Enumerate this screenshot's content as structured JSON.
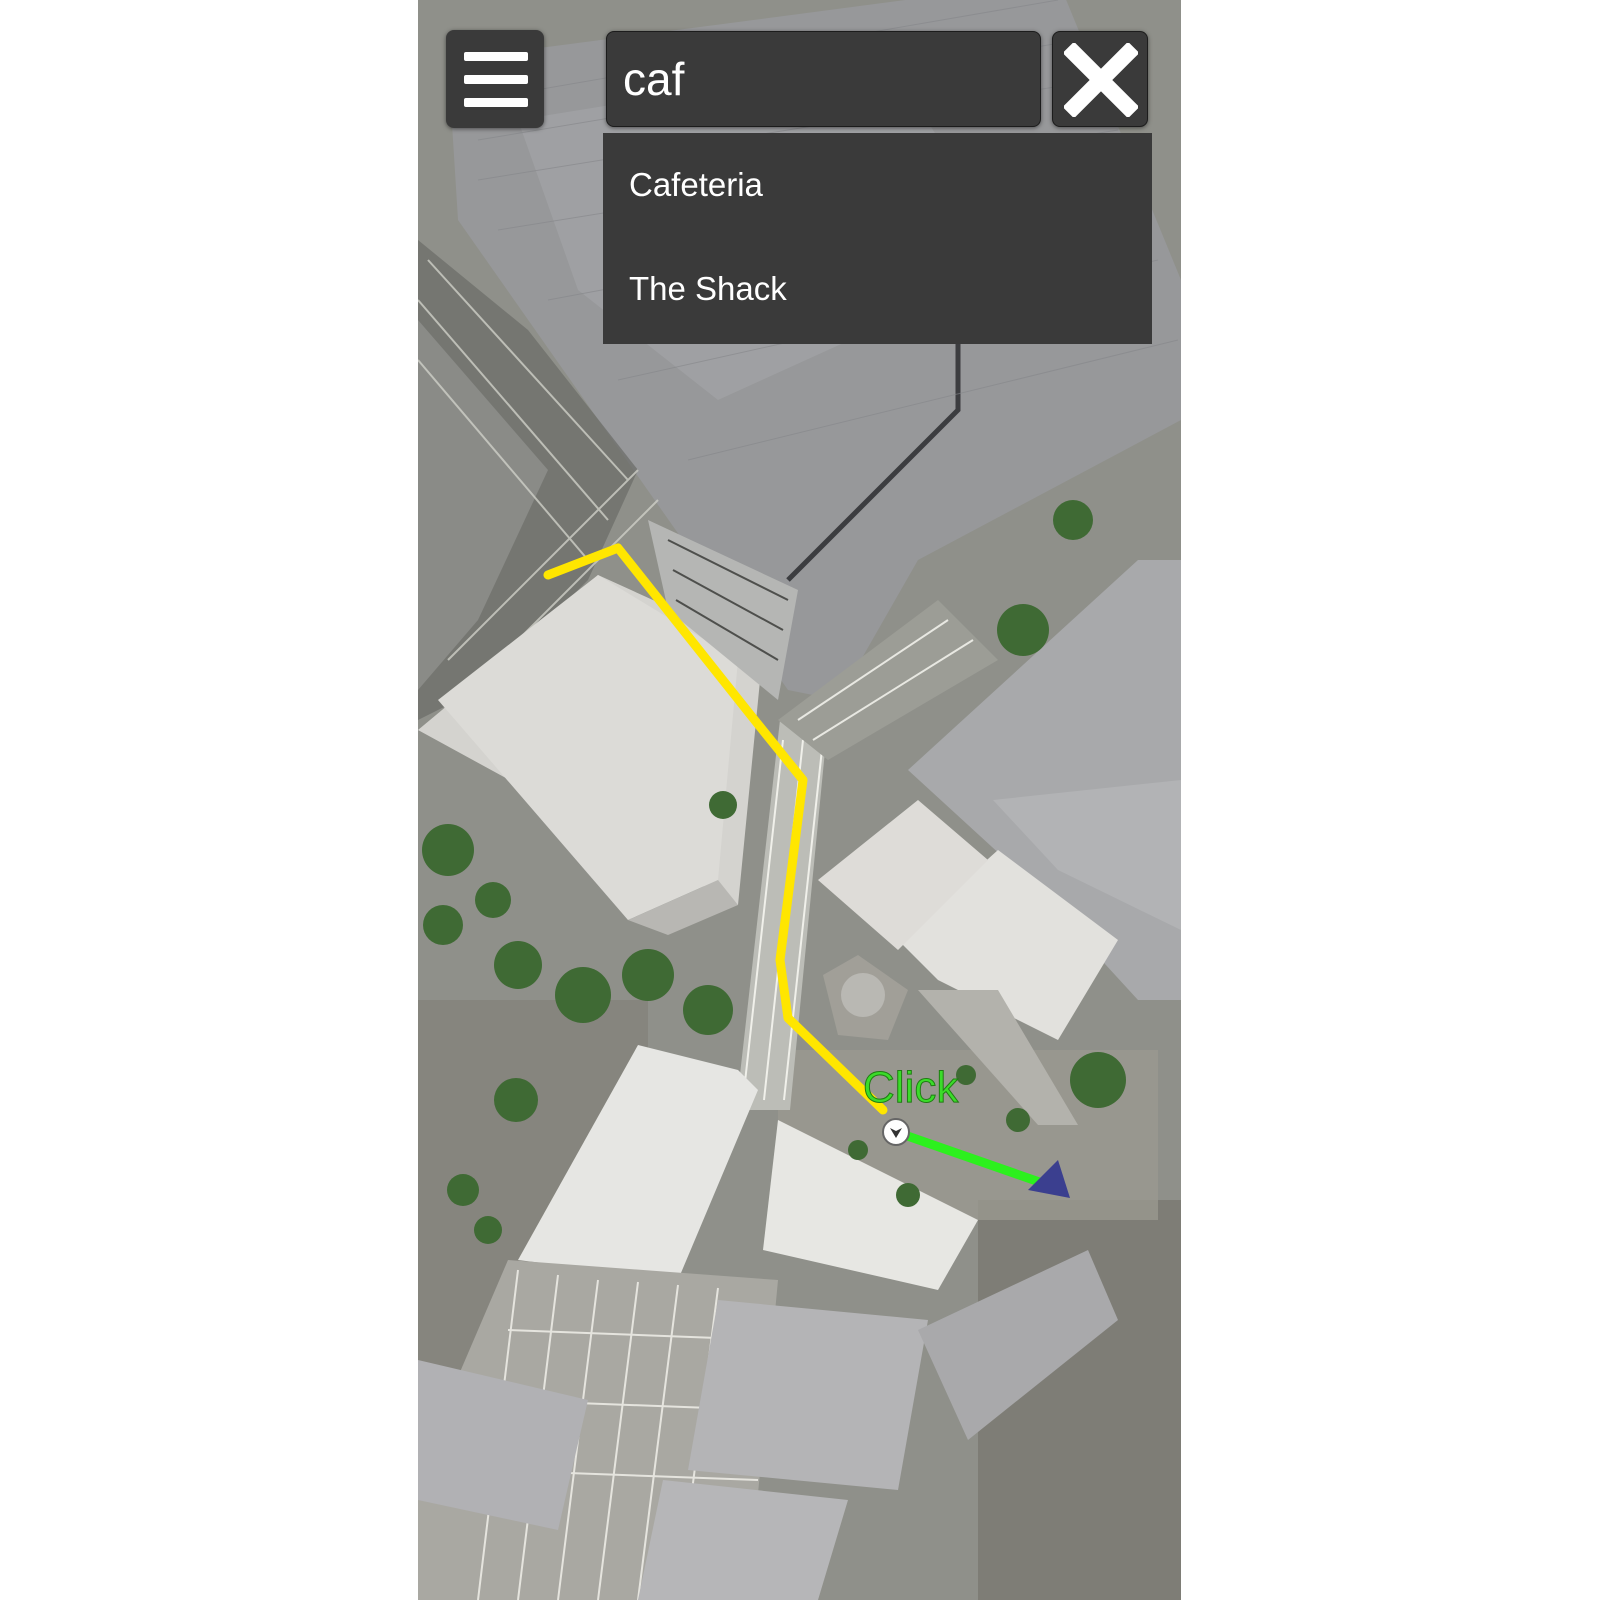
{
  "app": {
    "view": "satellite-campus-map"
  },
  "search": {
    "value": "caf",
    "placeholder": ""
  },
  "suggestions": [
    {
      "label": "Cafeteria"
    },
    {
      "label": "The Shack"
    }
  ],
  "map": {
    "route_label": "Click",
    "colors": {
      "route_walked": "#ffe600",
      "route_remaining": "#2cf01e",
      "arrow": "#3b3f8f",
      "panel": "#3a3a3a",
      "panel_text": "#ffffff"
    }
  },
  "icons": {
    "menu": "hamburger-menu-icon",
    "close": "close-x-icon",
    "location": "location-marker-icon",
    "direction": "direction-arrow-icon"
  }
}
